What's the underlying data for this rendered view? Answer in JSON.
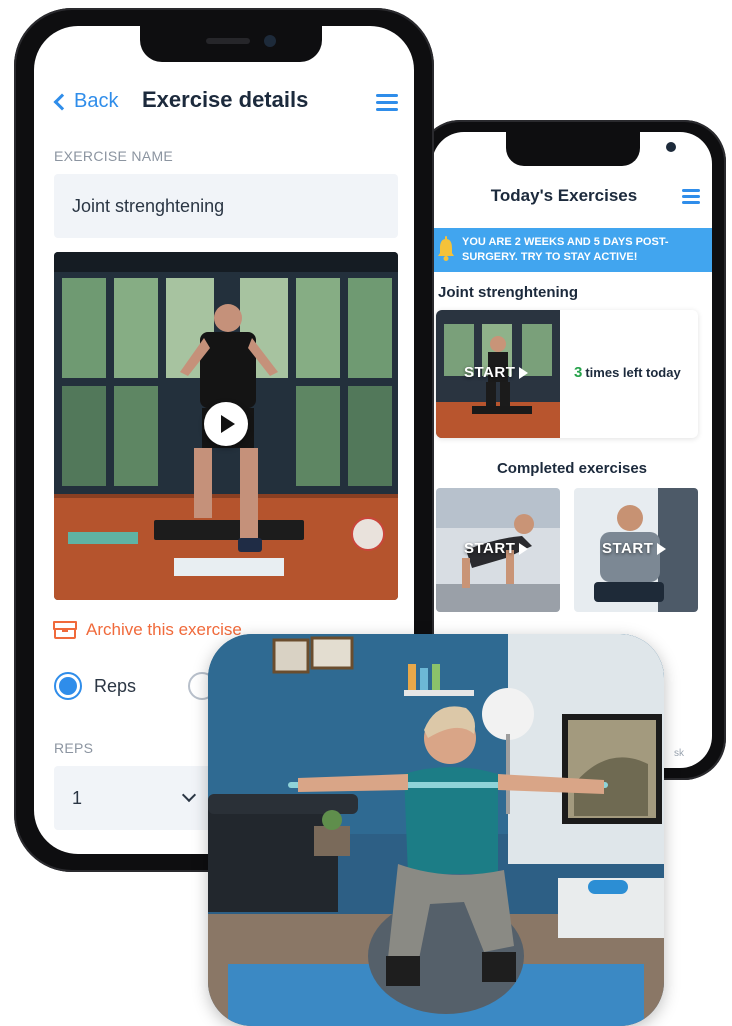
{
  "back_phone": {
    "title": "Today's Exercises",
    "banner": "You are 2 weeks and 5 days post-surgery. Try to stay active!",
    "section_exercise": "Joint strenghtening",
    "start_label": "START",
    "times_left_count": "3",
    "times_left_text": "times left today",
    "completed_title": "Completed exercises",
    "nav_partial": "sk"
  },
  "front_phone": {
    "back_label": "Back",
    "title": "Exercise details",
    "name_label": "EXERCISE NAME",
    "name_value": "Joint strenghtening",
    "archive_label": "Archive this exercise",
    "radio_reps_label": "Reps",
    "reps_label": "REPS",
    "reps_value": "1"
  },
  "colors": {
    "accent": "#2f8dea",
    "banner": "#41a5ef",
    "archive": "#f06a3b",
    "count_green": "#26a24a",
    "heading": "#1c2a3c"
  },
  "icons": [
    "chevron-left-icon",
    "hamburger-menu-icon",
    "bell-icon",
    "play-icon",
    "archive-box-icon",
    "chevron-down-icon"
  ]
}
